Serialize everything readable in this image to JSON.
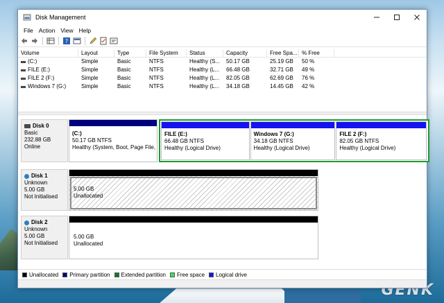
{
  "window": {
    "title": "Disk Management"
  },
  "menu": [
    "File",
    "Action",
    "View",
    "Help"
  ],
  "toolbar": {
    "icons": [
      "back-arrow-icon",
      "forward-arrow-icon",
      "properties-grid-icon",
      "help-icon",
      "list-view-icon",
      "edit-drive-icon",
      "checklist-icon",
      "console-icon"
    ]
  },
  "volume_table": {
    "headers": [
      "Volume",
      "Layout",
      "Type",
      "File System",
      "Status",
      "Capacity",
      "Free Spa...",
      "% Free"
    ],
    "rows": [
      [
        "(C:)",
        "Simple",
        "Basic",
        "NTFS",
        "Healthy (S...",
        "50.17 GB",
        "25.19 GB",
        "50 %"
      ],
      [
        "FILE (E:)",
        "Simple",
        "Basic",
        "NTFS",
        "Healthy (L...",
        "66.48 GB",
        "32.71 GB",
        "49 %"
      ],
      [
        "FILE 2 (F:)",
        "Simple",
        "Basic",
        "NTFS",
        "Healthy (L...",
        "82.05 GB",
        "62.69 GB",
        "76 %"
      ],
      [
        "Windows 7 (G:)",
        "Simple",
        "Basic",
        "NTFS",
        "Healthy (L...",
        "34.18 GB",
        "14.45 GB",
        "42 %"
      ]
    ]
  },
  "disks": [
    {
      "name": "Disk 0",
      "type": "Basic",
      "size": "232.88 GB",
      "state": "Online",
      "primary": {
        "name": "(C:)",
        "size": "50.17 GB NTFS",
        "status": "Healthy (System, Boot, Page File,"
      },
      "logical": [
        {
          "name": "FILE  (E:)",
          "size": "66.48 GB NTFS",
          "status": "Healthy (Logical Drive)"
        },
        {
          "name": "Windows 7  (G:)",
          "size": "34.18 GB NTFS",
          "status": "Healthy (Logical Drive)"
        },
        {
          "name": "FILE 2  (F:)",
          "size": "82.05 GB NTFS",
          "status": "Healthy (Logical Drive)"
        }
      ]
    },
    {
      "name": "Disk 1",
      "type": "Unknown",
      "size": "5.00 GB",
      "state": "Not Initialised",
      "unallocated": {
        "size": "5.00 GB",
        "label": "Unallocated"
      }
    },
    {
      "name": "Disk 2",
      "type": "Unknown",
      "size": "5.00 GB",
      "state": "Not Initialised",
      "unallocated": {
        "size": "5.00 GB",
        "label": "Unallocated"
      }
    }
  ],
  "legend": [
    {
      "label": "Unallocated",
      "color": "#000000"
    },
    {
      "label": "Primary partition",
      "color": "#00007e"
    },
    {
      "label": "Extended partition",
      "color": "#0f7f1f"
    },
    {
      "label": "Free space",
      "color": "#39e64a"
    },
    {
      "label": "Logical drive",
      "color": "#1414f0"
    }
  ],
  "colors": {
    "primary_bar": "#00007e",
    "logical_bar": "#1414f0",
    "unallocated_bar": "#000000",
    "extended_border": "#1f9a2e"
  },
  "watermark": "GENK"
}
